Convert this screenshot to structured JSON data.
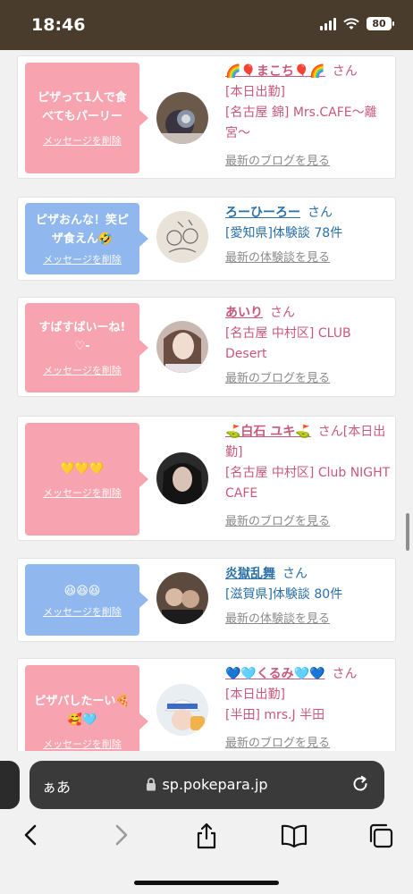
{
  "status_bar": {
    "time": "18:46",
    "battery": "80"
  },
  "cards": [
    {
      "bubble_color": "pink",
      "message": "ピザって1人で食べてもパーリー",
      "delete_label": "メッセージを削除",
      "name": "🌈🎈まこち🎈🌈",
      "name_color": "pink",
      "honorific": "さん",
      "details": [
        "[本日出勤]",
        "[名古屋 錦] Mrs.CAFE〜離宮〜"
      ],
      "details_color": "pink",
      "link": "最新のブログを見る",
      "avatar_icon": "profile-photo-icon"
    },
    {
      "bubble_color": "blue",
      "message": "ピザおんな！笑ピザ食えん🤣",
      "delete_label": "メッセージを削除",
      "name": "ろーひーろー",
      "name_color": "blue",
      "honorific": "さん",
      "details": [
        "[愛知県]体験談 78件"
      ],
      "details_color": "blue",
      "link": "最新の体験談を見る",
      "avatar_icon": "drawing-avatar-icon"
    },
    {
      "bubble_color": "pink",
      "message": "すばすばいーね!♡-",
      "delete_label": "メッセージを削除",
      "name": "あいり",
      "name_color": "pink",
      "honorific": "さん",
      "details": [
        "[名古屋 中村区] CLUB Desert"
      ],
      "details_color": "pink",
      "link": "最新のブログを見る",
      "avatar_icon": "profile-photo-icon"
    },
    {
      "bubble_color": "pink",
      "message": "💛💛💛",
      "delete_label": "メッセージを削除",
      "name": "⛳白石 ユキ⛳",
      "name_color": "pink",
      "honorific": "さん[本日出勤]",
      "details": [
        "[名古屋 中村区] Club NIGHT CAFE"
      ],
      "details_color": "pink",
      "link": "最新のブログを見る",
      "avatar_icon": "profile-photo-icon"
    },
    {
      "bubble_color": "blue",
      "message": "😆😆😆",
      "delete_label": "メッセージを削除",
      "name": "炎獄乱舞",
      "name_color": "blue",
      "honorific": "さん",
      "details": [
        "[滋賀県]体験談 80件"
      ],
      "details_color": "blue",
      "link": "最新の体験談を見る",
      "avatar_icon": "profile-photo-icon"
    },
    {
      "bubble_color": "pink",
      "message": "ピザパしたーい🍕🥰🩵",
      "delete_label": "メッセージを削除",
      "name": "💙🩵くるみ🩵💙",
      "name_color": "pink",
      "honorific": "さん",
      "details": [
        "[本日出勤]",
        "[半田] mrs.J 半田"
      ],
      "details_color": "pink",
      "link": "最新のブログを見る",
      "avatar_icon": "profile-photo-icon"
    }
  ],
  "browser": {
    "aa_label": "ぁあ",
    "url": "sp.pokepara.jp"
  }
}
